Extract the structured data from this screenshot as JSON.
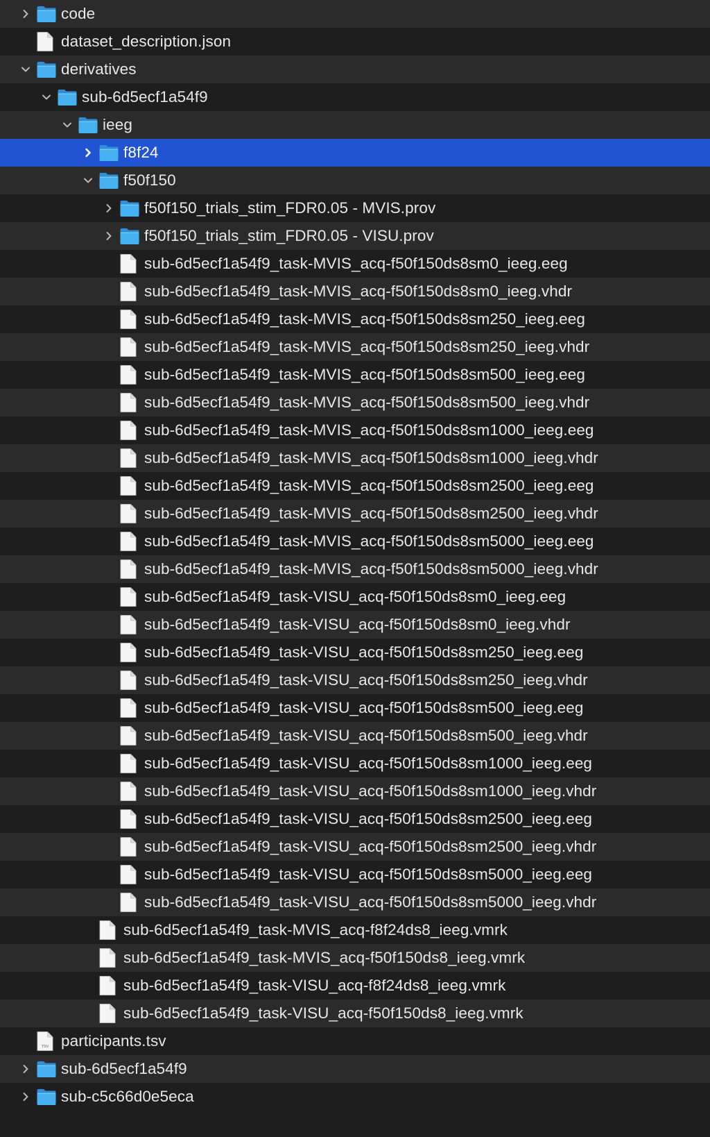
{
  "colors": {
    "row_dark": "#1e1e1e",
    "row_light": "#2b2b2b",
    "selected": "#2154d3",
    "folder": "#46b1f0",
    "text": "#e8e8e8"
  },
  "tree": [
    {
      "label": "code",
      "kind": "folder",
      "depth": 0,
      "state": "collapsed",
      "icon": "folder-icon"
    },
    {
      "label": "dataset_description.json",
      "kind": "file",
      "depth": 0,
      "icon": "document-icon"
    },
    {
      "label": "derivatives",
      "kind": "folder",
      "depth": 0,
      "state": "expanded",
      "icon": "folder-icon"
    },
    {
      "label": "sub-6d5ecf1a54f9",
      "kind": "folder",
      "depth": 1,
      "state": "expanded",
      "icon": "folder-icon"
    },
    {
      "label": "ieeg",
      "kind": "folder",
      "depth": 2,
      "state": "expanded",
      "icon": "folder-icon"
    },
    {
      "label": "f8f24",
      "kind": "folder",
      "depth": 3,
      "state": "collapsed",
      "selected": true,
      "icon": "folder-icon"
    },
    {
      "label": "f50f150",
      "kind": "folder",
      "depth": 3,
      "state": "expanded",
      "icon": "folder-icon"
    },
    {
      "label": "f50f150_trials_stim_FDR0.05 - MVIS.prov",
      "kind": "folder",
      "depth": 4,
      "state": "collapsed",
      "icon": "folder-icon"
    },
    {
      "label": "f50f150_trials_stim_FDR0.05 - VISU.prov",
      "kind": "folder",
      "depth": 4,
      "state": "collapsed",
      "icon": "folder-icon"
    },
    {
      "label": "sub-6d5ecf1a54f9_task-MVIS_acq-f50f150ds8sm0_ieeg.eeg",
      "kind": "file",
      "depth": 4,
      "icon": "document-icon"
    },
    {
      "label": "sub-6d5ecf1a54f9_task-MVIS_acq-f50f150ds8sm0_ieeg.vhdr",
      "kind": "file",
      "depth": 4,
      "icon": "document-icon"
    },
    {
      "label": "sub-6d5ecf1a54f9_task-MVIS_acq-f50f150ds8sm250_ieeg.eeg",
      "kind": "file",
      "depth": 4,
      "icon": "document-icon"
    },
    {
      "label": "sub-6d5ecf1a54f9_task-MVIS_acq-f50f150ds8sm250_ieeg.vhdr",
      "kind": "file",
      "depth": 4,
      "icon": "document-icon"
    },
    {
      "label": "sub-6d5ecf1a54f9_task-MVIS_acq-f50f150ds8sm500_ieeg.eeg",
      "kind": "file",
      "depth": 4,
      "icon": "document-icon"
    },
    {
      "label": "sub-6d5ecf1a54f9_task-MVIS_acq-f50f150ds8sm500_ieeg.vhdr",
      "kind": "file",
      "depth": 4,
      "icon": "document-icon"
    },
    {
      "label": "sub-6d5ecf1a54f9_task-MVIS_acq-f50f150ds8sm1000_ieeg.eeg",
      "kind": "file",
      "depth": 4,
      "icon": "document-icon"
    },
    {
      "label": "sub-6d5ecf1a54f9_task-MVIS_acq-f50f150ds8sm1000_ieeg.vhdr",
      "kind": "file",
      "depth": 4,
      "icon": "document-icon"
    },
    {
      "label": "sub-6d5ecf1a54f9_task-MVIS_acq-f50f150ds8sm2500_ieeg.eeg",
      "kind": "file",
      "depth": 4,
      "icon": "document-icon"
    },
    {
      "label": "sub-6d5ecf1a54f9_task-MVIS_acq-f50f150ds8sm2500_ieeg.vhdr",
      "kind": "file",
      "depth": 4,
      "icon": "document-icon"
    },
    {
      "label": "sub-6d5ecf1a54f9_task-MVIS_acq-f50f150ds8sm5000_ieeg.eeg",
      "kind": "file",
      "depth": 4,
      "icon": "document-icon"
    },
    {
      "label": "sub-6d5ecf1a54f9_task-MVIS_acq-f50f150ds8sm5000_ieeg.vhdr",
      "kind": "file",
      "depth": 4,
      "icon": "document-icon"
    },
    {
      "label": "sub-6d5ecf1a54f9_task-VISU_acq-f50f150ds8sm0_ieeg.eeg",
      "kind": "file",
      "depth": 4,
      "icon": "document-icon"
    },
    {
      "label": "sub-6d5ecf1a54f9_task-VISU_acq-f50f150ds8sm0_ieeg.vhdr",
      "kind": "file",
      "depth": 4,
      "icon": "document-icon"
    },
    {
      "label": "sub-6d5ecf1a54f9_task-VISU_acq-f50f150ds8sm250_ieeg.eeg",
      "kind": "file",
      "depth": 4,
      "icon": "document-icon"
    },
    {
      "label": "sub-6d5ecf1a54f9_task-VISU_acq-f50f150ds8sm250_ieeg.vhdr",
      "kind": "file",
      "depth": 4,
      "icon": "document-icon"
    },
    {
      "label": "sub-6d5ecf1a54f9_task-VISU_acq-f50f150ds8sm500_ieeg.eeg",
      "kind": "file",
      "depth": 4,
      "icon": "document-icon"
    },
    {
      "label": "sub-6d5ecf1a54f9_task-VISU_acq-f50f150ds8sm500_ieeg.vhdr",
      "kind": "file",
      "depth": 4,
      "icon": "document-icon"
    },
    {
      "label": "sub-6d5ecf1a54f9_task-VISU_acq-f50f150ds8sm1000_ieeg.eeg",
      "kind": "file",
      "depth": 4,
      "icon": "document-icon"
    },
    {
      "label": "sub-6d5ecf1a54f9_task-VISU_acq-f50f150ds8sm1000_ieeg.vhdr",
      "kind": "file",
      "depth": 4,
      "icon": "document-icon"
    },
    {
      "label": "sub-6d5ecf1a54f9_task-VISU_acq-f50f150ds8sm2500_ieeg.eeg",
      "kind": "file",
      "depth": 4,
      "icon": "document-icon"
    },
    {
      "label": "sub-6d5ecf1a54f9_task-VISU_acq-f50f150ds8sm2500_ieeg.vhdr",
      "kind": "file",
      "depth": 4,
      "icon": "document-icon"
    },
    {
      "label": "sub-6d5ecf1a54f9_task-VISU_acq-f50f150ds8sm5000_ieeg.eeg",
      "kind": "file",
      "depth": 4,
      "icon": "document-icon"
    },
    {
      "label": "sub-6d5ecf1a54f9_task-VISU_acq-f50f150ds8sm5000_ieeg.vhdr",
      "kind": "file",
      "depth": 4,
      "icon": "document-icon"
    },
    {
      "label": "sub-6d5ecf1a54f9_task-MVIS_acq-f8f24ds8_ieeg.vmrk",
      "kind": "file",
      "depth": 3,
      "icon": "document-icon"
    },
    {
      "label": "sub-6d5ecf1a54f9_task-MVIS_acq-f50f150ds8_ieeg.vmrk",
      "kind": "file",
      "depth": 3,
      "icon": "document-icon"
    },
    {
      "label": "sub-6d5ecf1a54f9_task-VISU_acq-f8f24ds8_ieeg.vmrk",
      "kind": "file",
      "depth": 3,
      "icon": "document-icon"
    },
    {
      "label": "sub-6d5ecf1a54f9_task-VISU_acq-f50f150ds8_ieeg.vmrk",
      "kind": "file",
      "depth": 3,
      "icon": "document-icon"
    },
    {
      "label": "participants.tsv",
      "kind": "file",
      "depth": 0,
      "icon": "tsv-file-icon",
      "badge": "TSV"
    },
    {
      "label": "sub-6d5ecf1a54f9",
      "kind": "folder",
      "depth": 0,
      "state": "collapsed",
      "icon": "folder-icon"
    },
    {
      "label": "sub-c5c66d0e5eca",
      "kind": "folder",
      "depth": 0,
      "state": "collapsed",
      "icon": "folder-icon"
    }
  ]
}
